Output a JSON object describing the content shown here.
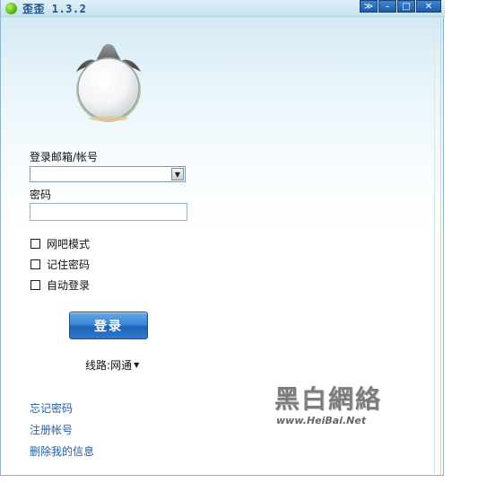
{
  "window": {
    "title": "歪歪 1.3.2"
  },
  "titlebar_buttons": {
    "collapse": "≫",
    "minimize": "–",
    "maximize": "□",
    "close": "✕"
  },
  "login": {
    "account_label": "登录邮箱/帐号",
    "account_value": "",
    "password_label": "密码",
    "password_value": "",
    "options": [
      {
        "label": "网吧模式",
        "checked": false
      },
      {
        "label": "记住密码",
        "checked": false
      },
      {
        "label": "自动登录",
        "checked": false
      }
    ],
    "login_button": "登录",
    "route_label": "线路",
    "route_separator": ":",
    "route_value": "网通"
  },
  "links": {
    "forgot_password": "忘记密码",
    "register": "注册帐号",
    "delete_info": "删除我的信息"
  },
  "watermark": {
    "line1": "黑白網絡",
    "line2": "www.HeiBai.Net"
  }
}
